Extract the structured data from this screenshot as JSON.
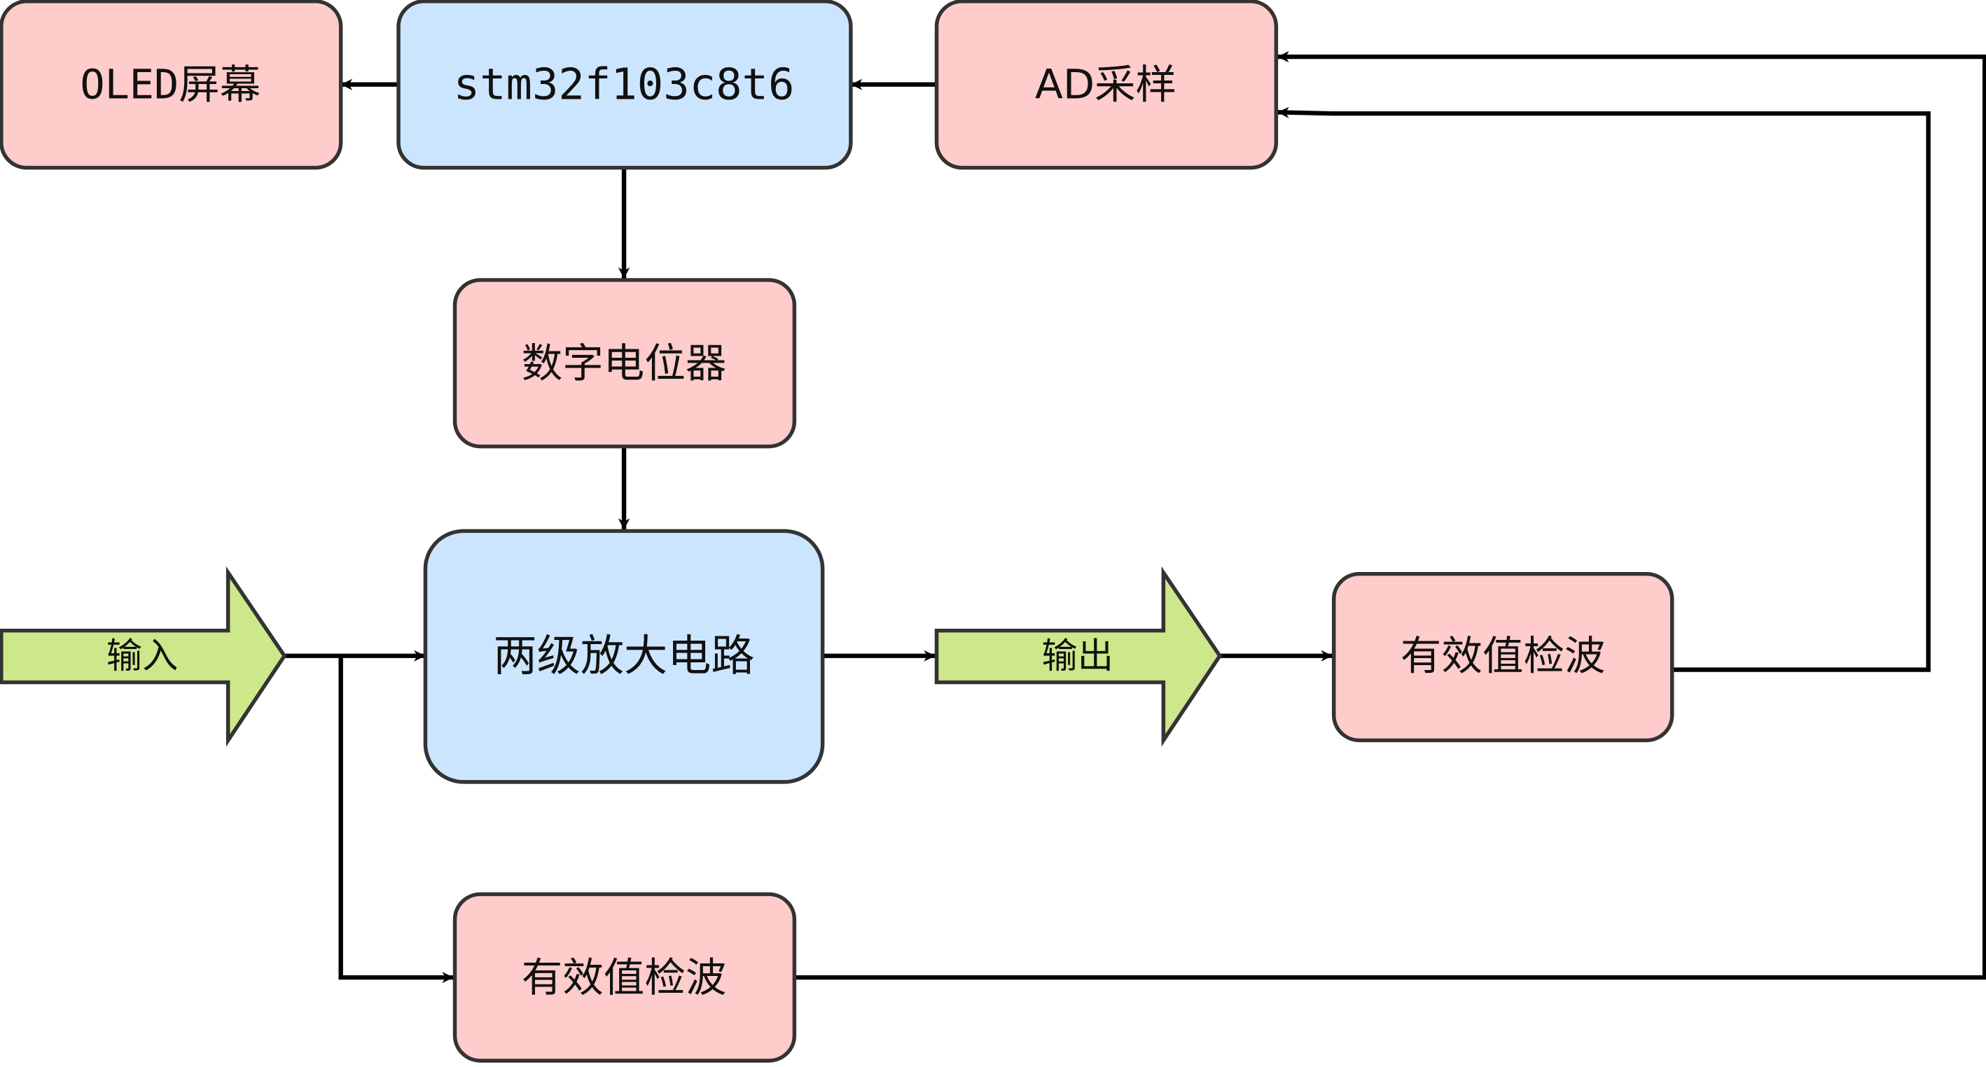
{
  "colors": {
    "pink": "#ffcccc",
    "blue": "#cce5ff",
    "green": "#cde88a",
    "stroke": "#333333"
  },
  "nodes": {
    "oled": "OLED屏幕",
    "mcu": "stm32f103c8t6",
    "adc": "AD采样",
    "digipot": "数字电位器",
    "amp": "两级放大电路",
    "rms_out": "有效值检波",
    "rms_in": "有效值检波",
    "input": "输入",
    "output": "输出"
  }
}
